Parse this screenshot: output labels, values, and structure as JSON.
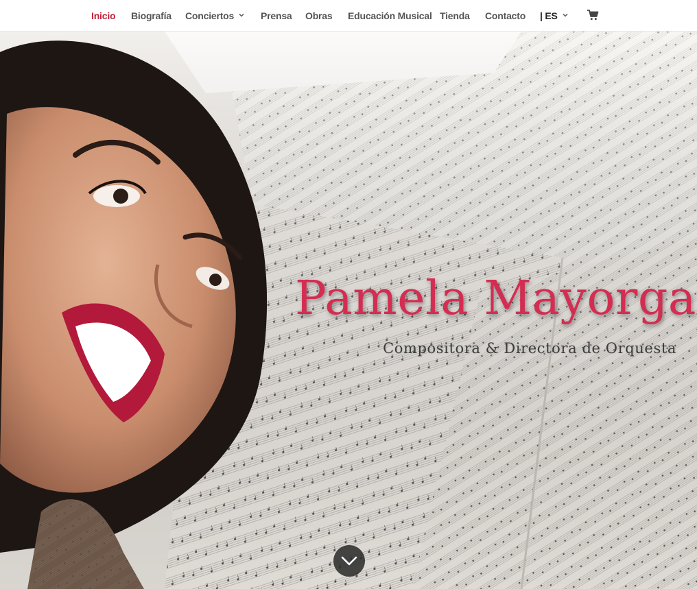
{
  "nav": {
    "items": [
      {
        "label": "Inicio",
        "active": true
      },
      {
        "label": "Biografía"
      },
      {
        "label": "Conciertos",
        "has_dropdown": true
      },
      {
        "label": "Prensa"
      },
      {
        "label": "Obras"
      },
      {
        "label": "Educación Musical"
      },
      {
        "label": "Tienda"
      },
      {
        "label": "Contacto"
      },
      {
        "label": "| ES",
        "has_dropdown": true
      }
    ],
    "cart_icon": "shopping-cart-icon"
  },
  "hero": {
    "title": "Pamela Mayorga",
    "subtitle": "Compositora & Directora de Orquesta",
    "scroll_icon": "chevron-down-icon"
  },
  "colors": {
    "accent": "#c4213a",
    "title": "#d42d52",
    "nav_text": "#555555"
  }
}
